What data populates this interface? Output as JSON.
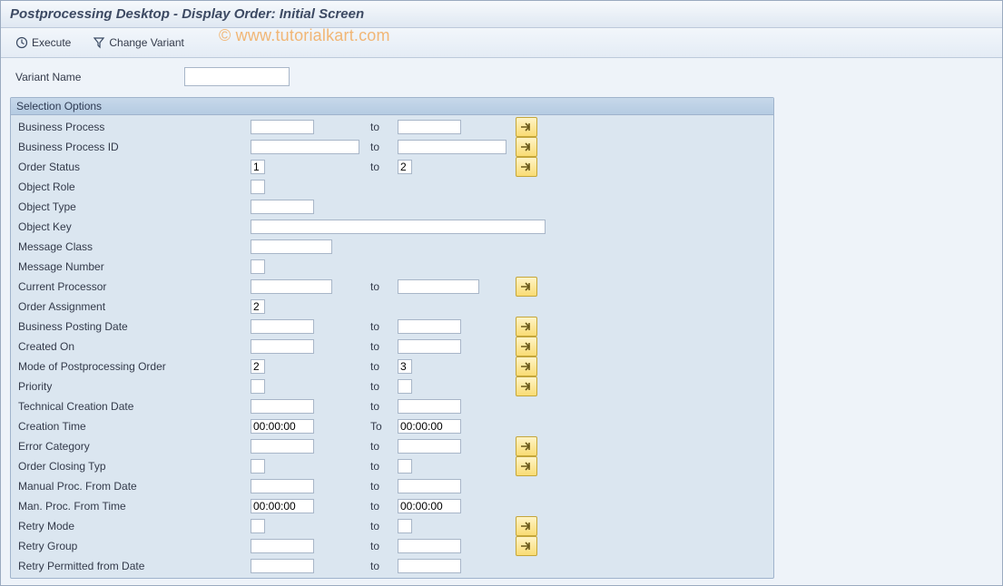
{
  "title": "Postprocessing Desktop  - Display Order: Initial Screen",
  "toolbar": {
    "execute": "Execute",
    "changeVariant": "Change Variant"
  },
  "watermark": "© www.tutorialkart.com",
  "variant": {
    "label": "Variant Name",
    "value": ""
  },
  "panel": {
    "header": "Selection Options",
    "rows": [
      {
        "label": "Business Process",
        "from": "",
        "fromW": "w-short",
        "toLbl": "to",
        "to": "",
        "toW": "w-short",
        "arrow": true
      },
      {
        "label": "Business Process ID",
        "from": "",
        "fromW": "w-long",
        "toLbl": "to",
        "to": "",
        "toW": "w-long",
        "arrow": true
      },
      {
        "label": "Order Status",
        "from": "1",
        "fromW": "w-tiny",
        "toLbl": "to",
        "to": "2",
        "toW": "w-tiny",
        "arrow": true
      },
      {
        "label": "Object Role",
        "from": "",
        "fromW": "w-tiny",
        "toLbl": "",
        "to": null,
        "toW": "",
        "arrow": false
      },
      {
        "label": "Object Type",
        "from": "",
        "fromW": "w-short",
        "toLbl": "",
        "to": null,
        "toW": "",
        "arrow": false
      },
      {
        "label": "Object Key",
        "from": "",
        "fromW": "w-xlong",
        "toLbl": "",
        "to": null,
        "toW": "",
        "arrow": false
      },
      {
        "label": "Message Class",
        "from": "",
        "fromW": "w-med",
        "toLbl": "",
        "to": null,
        "toW": "",
        "arrow": false
      },
      {
        "label": "Message Number",
        "from": "",
        "fromW": "w-tiny",
        "toLbl": "",
        "to": null,
        "toW": "",
        "arrow": false
      },
      {
        "label": "Current Processor",
        "from": "",
        "fromW": "w-med",
        "toLbl": "to",
        "to": "",
        "toW": "w-med",
        "arrow": true
      },
      {
        "label": "Order Assignment",
        "from": "2",
        "fromW": "w-tiny",
        "toLbl": "",
        "to": null,
        "toW": "",
        "arrow": false
      },
      {
        "label": "Business Posting Date",
        "from": "",
        "fromW": "w-short",
        "toLbl": "to",
        "to": "",
        "toW": "w-short",
        "arrow": true
      },
      {
        "label": "Created On",
        "from": "",
        "fromW": "w-short",
        "toLbl": "to",
        "to": "",
        "toW": "w-short",
        "arrow": true
      },
      {
        "label": "Mode of Postprocessing Order",
        "from": "2",
        "fromW": "w-tiny",
        "toLbl": "to",
        "to": "3",
        "toW": "w-tiny",
        "arrow": true
      },
      {
        "label": "Priority",
        "from": "",
        "fromW": "w-tiny",
        "toLbl": "to",
        "to": "",
        "toW": "w-tiny",
        "arrow": true
      },
      {
        "label": "Technical Creation Date",
        "from": "",
        "fromW": "w-short",
        "toLbl": "to",
        "to": "",
        "toW": "w-short",
        "arrow": false
      },
      {
        "label": "Creation Time",
        "from": "00:00:00",
        "fromW": "w-short",
        "toLbl": "To",
        "to": "00:00:00",
        "toW": "w-short",
        "arrow": false
      },
      {
        "label": "Error Category",
        "from": "",
        "fromW": "w-short",
        "toLbl": "to",
        "to": "",
        "toW": "w-short",
        "arrow": true
      },
      {
        "label": "Order Closing Typ",
        "from": "",
        "fromW": "w-tiny",
        "toLbl": "to",
        "to": "",
        "toW": "w-tiny",
        "arrow": true
      },
      {
        "label": "Manual Proc. From Date",
        "from": "",
        "fromW": "w-short",
        "toLbl": "to",
        "to": "",
        "toW": "w-short",
        "arrow": false
      },
      {
        "label": "Man. Proc. From Time",
        "from": "00:00:00",
        "fromW": "w-short",
        "toLbl": "to",
        "to": "00:00:00",
        "toW": "w-short",
        "arrow": false
      },
      {
        "label": "Retry Mode",
        "from": "",
        "fromW": "w-tiny",
        "toLbl": "to",
        "to": "",
        "toW": "w-tiny",
        "arrow": true
      },
      {
        "label": "Retry Group",
        "from": "",
        "fromW": "w-short",
        "toLbl": "to",
        "to": "",
        "toW": "w-short",
        "arrow": true
      },
      {
        "label": "Retry Permitted from Date",
        "from": "",
        "fromW": "w-short",
        "toLbl": "to",
        "to": "",
        "toW": "w-short",
        "arrow": false
      }
    ]
  }
}
